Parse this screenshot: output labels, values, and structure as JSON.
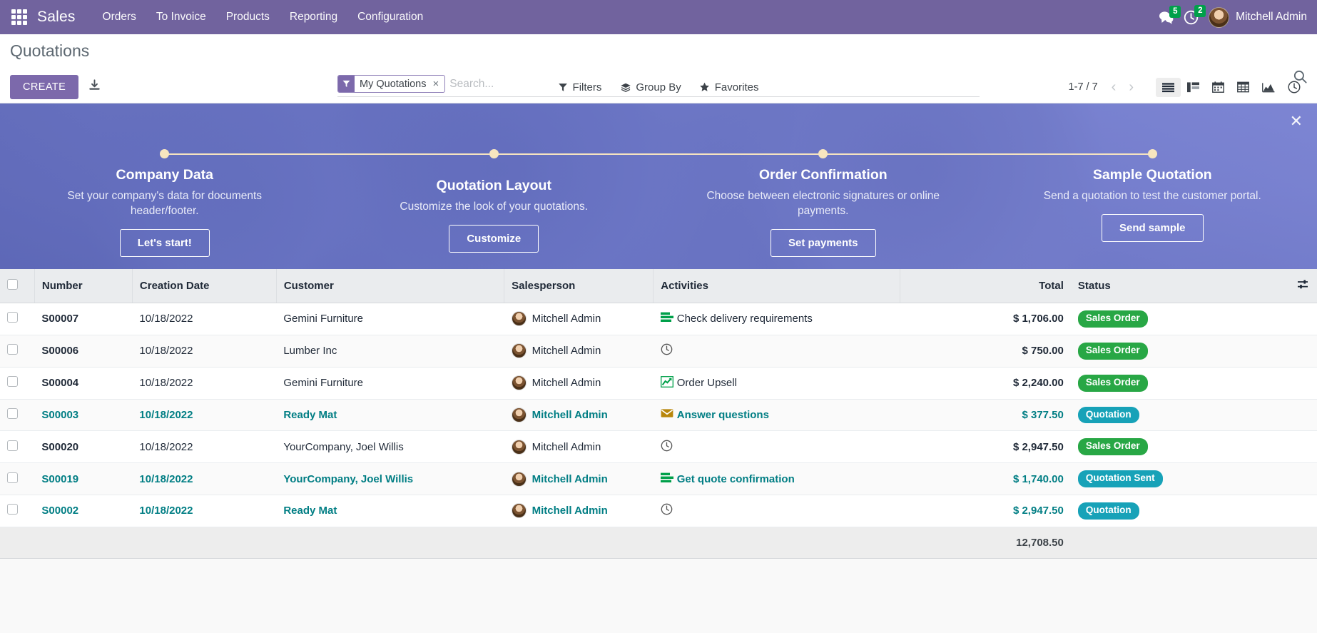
{
  "navbar": {
    "apps_icon": "apps-grid-icon",
    "brand": "Sales",
    "menu": [
      "Orders",
      "To Invoice",
      "Products",
      "Reporting",
      "Configuration"
    ],
    "tray": {
      "messages_icon": "chat-bubble-icon",
      "messages_count": "5",
      "activities_icon": "clock-icon",
      "activities_count": "2",
      "avatar_icon": "user-avatar",
      "user_name": "Mitchell Admin"
    },
    "colors": {
      "background": "#71639e",
      "badge": "#00a04a"
    }
  },
  "control_panel": {
    "page_title": "Quotations",
    "create_label": "CREATE",
    "download_icon": "download-icon",
    "search": {
      "facet_icon": "filter-funnel-icon",
      "facet_label": "My Quotations",
      "facet_remove_icon": "close-x-icon",
      "placeholder": "Search...",
      "value": "",
      "search_icon": "magnifier-icon"
    },
    "menus": [
      {
        "label": "Filters",
        "icon": "filter-funnel-icon"
      },
      {
        "label": "Group By",
        "icon": "layers-icon"
      },
      {
        "label": "Favorites",
        "icon": "star-icon"
      }
    ],
    "pager": "1-7 / 7",
    "prev_icon": "chevron-left-icon",
    "next_icon": "chevron-right-icon",
    "views": [
      {
        "name": "list",
        "icon": "list-view-icon",
        "active": true
      },
      {
        "name": "kanban",
        "icon": "kanban-view-icon",
        "active": false
      },
      {
        "name": "calendar",
        "icon": "calendar-view-icon",
        "active": false
      },
      {
        "name": "pivot",
        "icon": "pivot-view-icon",
        "active": false
      },
      {
        "name": "graph",
        "icon": "graph-view-icon",
        "active": false
      },
      {
        "name": "activity",
        "icon": "activity-view-icon",
        "active": false
      }
    ]
  },
  "banner": {
    "close_icon": "close-x-icon",
    "steps": [
      {
        "title": "Company Data",
        "desc": "Set your company's data for documents header/footer.",
        "button": "Let's start!",
        "lines": 2
      },
      {
        "title": "Quotation Layout",
        "desc": "Customize the look of your quotations.",
        "button": "Customize",
        "lines": 1
      },
      {
        "title": "Order Confirmation",
        "desc": "Choose between electronic signatures or online payments.",
        "button": "Set payments",
        "lines": 2
      },
      {
        "title": "Sample Quotation",
        "desc": "Send a quotation to test the customer portal.",
        "button": "Send sample",
        "lines": 2
      }
    ]
  },
  "table": {
    "columns": [
      "Number",
      "Creation Date",
      "Customer",
      "Salesperson",
      "Activities",
      "Total",
      "Status"
    ],
    "optional_columns_icon": "column-settings-icon",
    "select_all_icon": "checkbox-icon",
    "rows": [
      {
        "number": "S00007",
        "date": "10/18/2022",
        "customer": "Gemini Furniture",
        "salesperson": "Mitchell Admin",
        "activity": "Check delivery requirements",
        "activity_icon": "bars-list-icon",
        "activity_icon_color": "#00a04a",
        "total": "$ 1,706.00",
        "status": "Sales Order",
        "status_color": "#28a745",
        "highlight": false
      },
      {
        "number": "S00006",
        "date": "10/18/2022",
        "customer": "Lumber Inc",
        "salesperson": "Mitchell Admin",
        "activity": "",
        "activity_icon": "clock-icon",
        "activity_icon_color": "#555555",
        "total": "$ 750.00",
        "status": "Sales Order",
        "status_color": "#28a745",
        "highlight": false
      },
      {
        "number": "S00004",
        "date": "10/18/2022",
        "customer": "Gemini Furniture",
        "salesperson": "Mitchell Admin",
        "activity": "Order Upsell",
        "activity_icon": "chart-line-icon",
        "activity_icon_color": "#00a04a",
        "total": "$ 2,240.00",
        "status": "Sales Order",
        "status_color": "#28a745",
        "highlight": false
      },
      {
        "number": "S00003",
        "date": "10/18/2022",
        "customer": "Ready Mat",
        "salesperson": "Mitchell Admin",
        "activity": "Answer questions",
        "activity_icon": "envelope-icon",
        "activity_icon_color": "#b8860b",
        "total": "$ 377.50",
        "status": "Quotation",
        "status_color": "#17a2b8",
        "highlight": true
      },
      {
        "number": "S00020",
        "date": "10/18/2022",
        "customer": "YourCompany, Joel Willis",
        "salesperson": "Mitchell Admin",
        "activity": "",
        "activity_icon": "clock-icon",
        "activity_icon_color": "#555555",
        "total": "$ 2,947.50",
        "status": "Sales Order",
        "status_color": "#28a745",
        "highlight": false
      },
      {
        "number": "S00019",
        "date": "10/18/2022",
        "customer": "YourCompany, Joel Willis",
        "salesperson": "Mitchell Admin",
        "activity": "Get quote confirmation",
        "activity_icon": "bars-list-icon",
        "activity_icon_color": "#00a04a",
        "total": "$ 1,740.00",
        "status": "Quotation Sent",
        "status_color": "#17a2b8",
        "highlight": true
      },
      {
        "number": "S00002",
        "date": "10/18/2022",
        "customer": "Ready Mat",
        "salesperson": "Mitchell Admin",
        "activity": "",
        "activity_icon": "clock-icon",
        "activity_icon_color": "#555555",
        "total": "$ 2,947.50",
        "status": "Quotation",
        "status_color": "#17a2b8",
        "highlight": true
      }
    ],
    "footer_total": "12,708.50"
  }
}
